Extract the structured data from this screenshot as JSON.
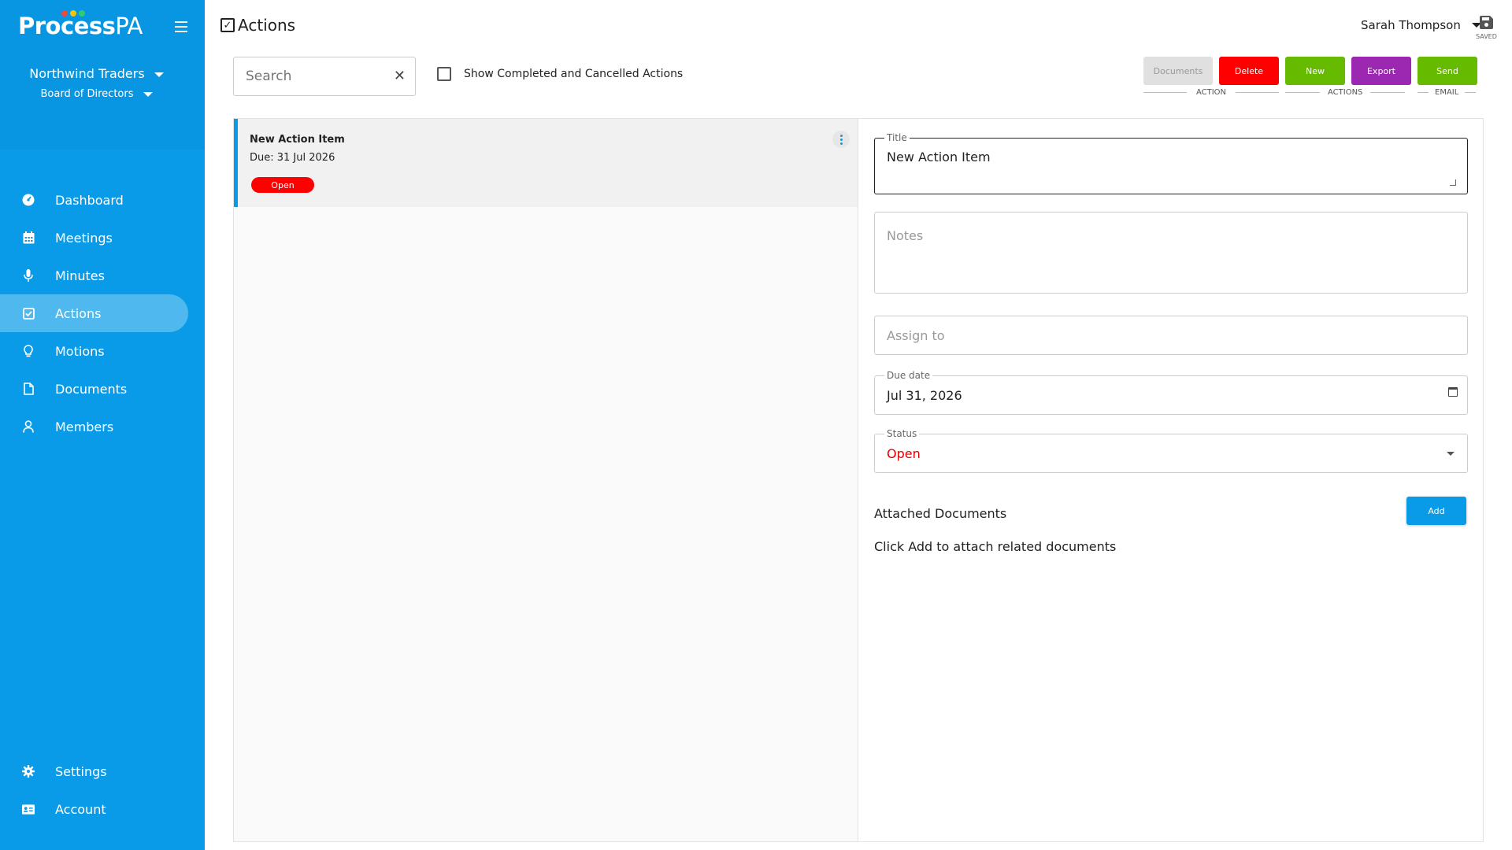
{
  "app": {
    "logo_main": "Process",
    "logo_suffix": "PA",
    "logo_dot_colors": [
      "#e74c3c",
      "#f1c40f",
      "#2ecc71"
    ]
  },
  "sidebar": {
    "org": "Northwind Traders",
    "board": "Board of Directors",
    "items": [
      {
        "label": "Dashboard",
        "icon": "dashboard-icon"
      },
      {
        "label": "Meetings",
        "icon": "calendar-icon"
      },
      {
        "label": "Minutes",
        "icon": "microphone-icon"
      },
      {
        "label": "Actions",
        "icon": "checkbox-icon",
        "active": true
      },
      {
        "label": "Motions",
        "icon": "lightbulb-icon"
      },
      {
        "label": "Documents",
        "icon": "document-icon"
      },
      {
        "label": "Members",
        "icon": "person-icon"
      }
    ],
    "bottom_items": [
      {
        "label": "Settings",
        "icon": "gear-icon"
      },
      {
        "label": "Account",
        "icon": "id-card-icon"
      }
    ]
  },
  "header": {
    "title": "Actions",
    "user": "Sarah Thompson",
    "saved_label": "SAVED"
  },
  "toolbar": {
    "search_placeholder": "Search",
    "show_completed_label": "Show Completed and Cancelled Actions",
    "buttons": {
      "documents": "Documents",
      "delete": "Delete",
      "new": "New",
      "export": "Export",
      "send": "Send"
    },
    "group_labels": {
      "action": "ACTION",
      "actions": "ACTIONS",
      "email": "EMAIL"
    },
    "colors": {
      "documents": "#e0e0e0",
      "delete": "#ff0000",
      "new": "#66bb00",
      "export": "#9c27b0",
      "send": "#66bb00"
    }
  },
  "list": {
    "items": [
      {
        "title": "New Action Item",
        "due": "Due: 31 Jul 2026",
        "status": "Open"
      }
    ]
  },
  "detail": {
    "title_label": "Title",
    "title_value": "New Action Item",
    "notes_placeholder": "Notes",
    "assign_placeholder": "Assign to",
    "due_label": "Due date",
    "due_value": "Jul 31, 2026",
    "status_label": "Status",
    "status_value": "Open",
    "status_color": "#e00000",
    "attached_title": "Attached Documents",
    "add_label": "Add",
    "attached_hint": "Click Add to attach related documents"
  }
}
